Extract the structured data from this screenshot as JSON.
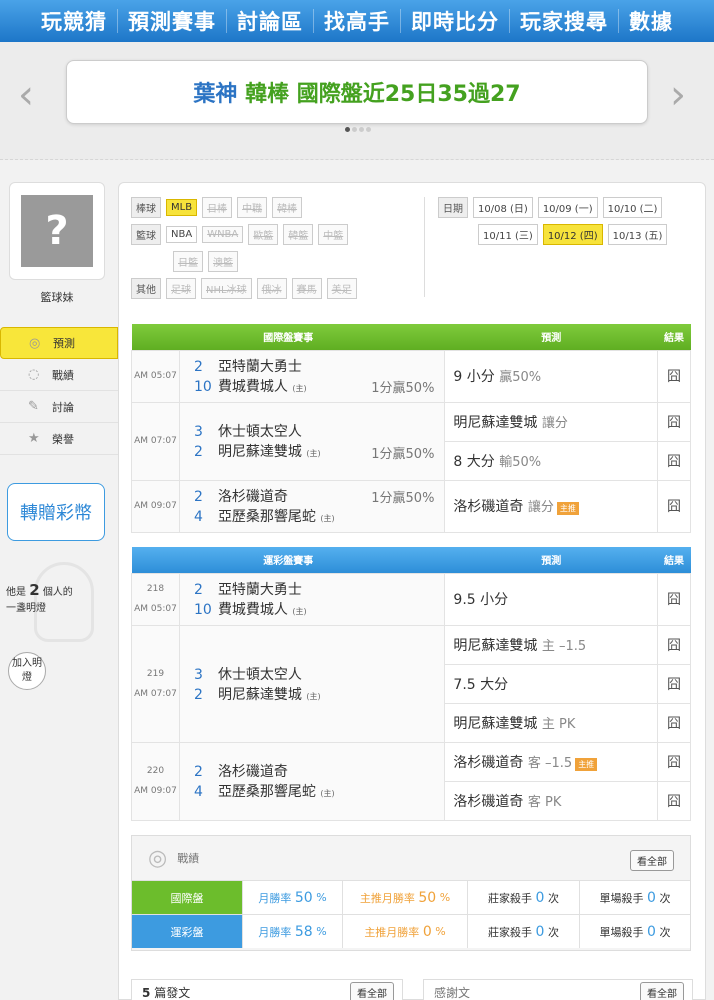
{
  "nav": {
    "items": [
      "玩競猜",
      "預測賽事",
      "討論區",
      "找高手",
      "即時比分",
      "玩家搜尋",
      "數據"
    ]
  },
  "banner": {
    "name1": "葉神",
    "name2": "韓棒",
    "text": "國際盤近25日35過27",
    "name1_color": "#2c74c4",
    "name2_color": "#44a11f",
    "text_color": "#44a11f"
  },
  "sidebar": {
    "username": "籃球妹",
    "menu": [
      "預測",
      "戰績",
      "討論",
      "榮譽"
    ],
    "gift": "轉贈彩幣",
    "light_prefix": "他是",
    "light_count": "2",
    "light_suffix": "個人的",
    "light_line2": "一盞明燈",
    "join": "加入明燈"
  },
  "filters": {
    "baseball_label": "棒球",
    "baseball": [
      "MLB",
      "日棒",
      "中職",
      "韓棒"
    ],
    "basketball_label": "籃球",
    "basketball": [
      "NBA",
      "WNBA",
      "歐籃",
      "韓籃",
      "中籃",
      "日籃",
      "澳籃"
    ],
    "other_label": "其他",
    "other": [
      "足球",
      "NHL冰球",
      "俄冰",
      "賽馬",
      "美足"
    ],
    "date_label": "日期",
    "dates": [
      "10/08 (日)",
      "10/09 (一)",
      "10/10 (二)",
      "10/11 (三)",
      "10/12 (四)",
      "10/13 (五)"
    ]
  },
  "intl": {
    "title": "國際盤賽事",
    "pred_h": "預測",
    "res_h": "結果",
    "home": "(主)",
    "result_icon": "囧",
    "games": [
      {
        "time": "AM 05:07",
        "t1n": "2",
        "t1": "亞特蘭大勇士",
        "t2n": "10",
        "t2": "費城費城人",
        "hcap": "1分贏50%",
        "p1": "9 小分",
        "p1s": "贏50%"
      },
      {
        "time": "AM 07:07",
        "t1n": "3",
        "t1": "休士頓太空人",
        "t2n": "2",
        "t2": "明尼蘇達雙城",
        "hcap": "1分贏50%",
        "p1": "明尼蘇達雙城",
        "p1s": "讓分",
        "p2": "8 大分",
        "p2s": "輸50%"
      },
      {
        "time": "AM 09:07",
        "t1n": "2",
        "t1": "洛杉磯道奇",
        "t2n": "4",
        "t2": "亞歷桑那響尾蛇",
        "hcap": "1分贏50%",
        "p1": "洛杉磯道奇",
        "p1s": "讓分",
        "tag": "主推"
      }
    ]
  },
  "sports": {
    "title": "運彩盤賽事",
    "pred_h": "預測",
    "res_h": "結果",
    "home": "(主)",
    "result_icon": "囧",
    "games": [
      {
        "no": "218",
        "time": "AM 05:07",
        "t1n": "2",
        "t1": "亞特蘭大勇士",
        "t2n": "10",
        "t2": "費城費城人",
        "p": [
          "9.5 小分"
        ],
        "ps": [
          ""
        ]
      },
      {
        "no": "219",
        "time": "AM 07:07",
        "t1n": "3",
        "t1": "休士頓太空人",
        "t2n": "2",
        "t2": "明尼蘇達雙城",
        "p": [
          "明尼蘇達雙城",
          "7.5 大分",
          "明尼蘇達雙城"
        ],
        "ps": [
          "主 –1.5",
          "",
          "主 PK"
        ]
      },
      {
        "no": "220",
        "time": "AM 09:07",
        "t1n": "2",
        "t1": "洛杉磯道奇",
        "t2n": "4",
        "t2": "亞歷桑那響尾蛇",
        "p": [
          "洛杉磯道奇",
          "洛杉磯道奇"
        ],
        "ps": [
          "客 –1.5",
          "客 PK"
        ],
        "tag": "主推"
      }
    ]
  },
  "stats": {
    "title": "戰績",
    "see_all": "看全部",
    "rows": [
      {
        "label": "國際盤",
        "color": "#6cbd2c",
        "c1l": "月勝率",
        "c1v": "50",
        "c2l": "主推月勝率",
        "c2v": "50",
        "c3l": "莊家殺手",
        "c3v": "0",
        "c4l": "單場殺手",
        "c4v": "0"
      },
      {
        "label": "運彩盤",
        "color": "#3d9be0",
        "c1l": "月勝率",
        "c1v": "58",
        "c2l": "主推月勝率",
        "c2v": "0",
        "c3l": "莊家殺手",
        "c3v": "0",
        "c4l": "單場殺手",
        "c4v": "0"
      }
    ],
    "pct": "%",
    "times": "次"
  },
  "posts": {
    "count": "5",
    "label": "篇發文",
    "see_all": "看全部"
  },
  "thanks": {
    "label": "感謝文",
    "see_all": "看全部"
  }
}
